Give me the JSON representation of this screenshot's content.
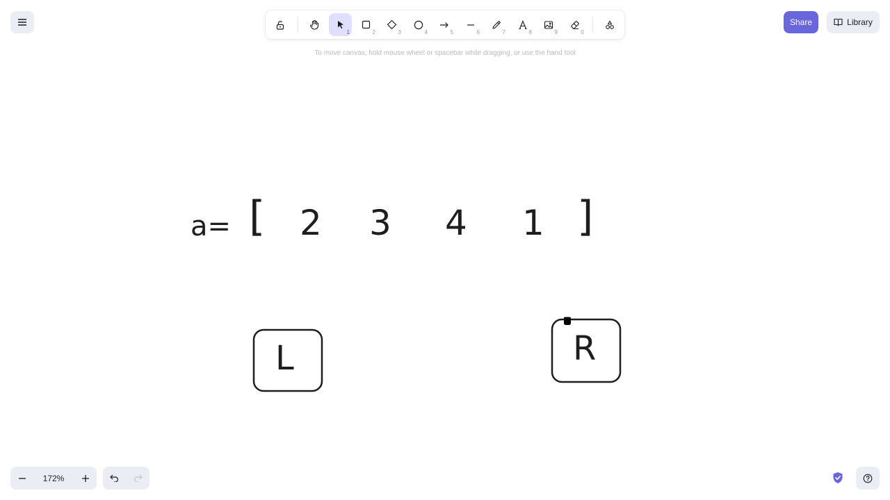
{
  "toolbar": {
    "tools": [
      {
        "name": "lock",
        "key": ""
      },
      {
        "name": "hand",
        "key": ""
      },
      {
        "name": "selection",
        "key": "1"
      },
      {
        "name": "rectangle",
        "key": "2"
      },
      {
        "name": "diamond",
        "key": "3"
      },
      {
        "name": "ellipse",
        "key": "4"
      },
      {
        "name": "arrow",
        "key": "5"
      },
      {
        "name": "line",
        "key": "6"
      },
      {
        "name": "draw",
        "key": "7"
      },
      {
        "name": "text",
        "key": "8"
      },
      {
        "name": "image",
        "key": "9"
      },
      {
        "name": "eraser",
        "key": "0"
      },
      {
        "name": "extra-tools",
        "key": ""
      }
    ],
    "active_tool": "selection"
  },
  "hint": "To move canvas, hold mouse wheel or spacebar while dragging, or use the hand tool",
  "top_right": {
    "share_label": "Share",
    "library_label": "Library"
  },
  "canvas": {
    "array_label": "a=",
    "open_bracket": "[",
    "close_bracket": "]",
    "array_values": [
      "2",
      "3",
      "4",
      "1"
    ],
    "box_left_label": "L",
    "box_right_label": "R"
  },
  "bottom": {
    "zoom_level": "172%",
    "zoom_out_symbol": "−",
    "zoom_in_symbol": "+"
  },
  "colors": {
    "accent": "#6965db",
    "active_tool_bg": "#e0dfff",
    "island_bg": "#ececf4",
    "stroke": "#1e1e1e"
  }
}
